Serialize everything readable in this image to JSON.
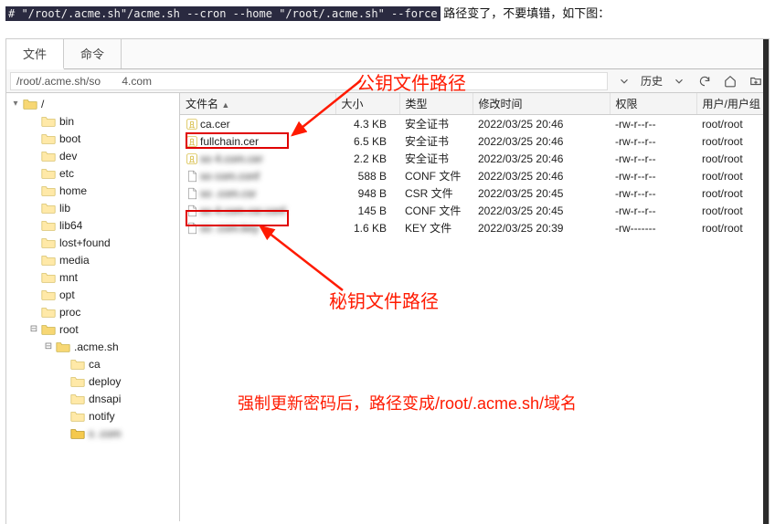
{
  "command_line": "# \"/root/.acme.sh\"/acme.sh --cron --home \"/root/.acme.sh\" --force",
  "command_note": "路径变了，不要填错，如下图：",
  "tabs": {
    "file": "文件",
    "cmd": "命令"
  },
  "path": "/root/.acme.sh/so       4.com",
  "toolbar": {
    "history": "历史"
  },
  "tree_root": "/",
  "tree": [
    {
      "label": "bin",
      "indent": 1
    },
    {
      "label": "boot",
      "indent": 1
    },
    {
      "label": "dev",
      "indent": 1
    },
    {
      "label": "etc",
      "indent": 1
    },
    {
      "label": "home",
      "indent": 1
    },
    {
      "label": "lib",
      "indent": 1
    },
    {
      "label": "lib64",
      "indent": 1
    },
    {
      "label": "lost+found",
      "indent": 1
    },
    {
      "label": "media",
      "indent": 1
    },
    {
      "label": "mnt",
      "indent": 1
    },
    {
      "label": "opt",
      "indent": 1
    },
    {
      "label": "proc",
      "indent": 1
    },
    {
      "label": "root",
      "indent": 1,
      "expandable": true,
      "expanded": true,
      "open": true
    },
    {
      "label": ".acme.sh",
      "indent": 2,
      "expandable": true,
      "expanded": true,
      "open": true
    },
    {
      "label": "ca",
      "indent": 3
    },
    {
      "label": "deploy",
      "indent": 3
    },
    {
      "label": "dnsapi",
      "indent": 3
    },
    {
      "label": "notify",
      "indent": 3
    },
    {
      "label": "s         .com",
      "indent": 3,
      "selected": true,
      "blur": true
    }
  ],
  "columns": {
    "name": "文件名",
    "size": "大小",
    "type": "类型",
    "mod": "修改时间",
    "perm": "权限",
    "owner": "用户/用户组"
  },
  "files": [
    {
      "name": "ca.cer",
      "size": "4.3 KB",
      "type": "安全证书",
      "mod": "2022/03/25 20:46",
      "perm": "-rw-r--r--",
      "owner": "root/root",
      "icon": "cert"
    },
    {
      "name": "fullchain.cer",
      "size": "6.5 KB",
      "type": "安全证书",
      "mod": "2022/03/25 20:46",
      "perm": "-rw-r--r--",
      "owner": "root/root",
      "icon": "cert"
    },
    {
      "name": "so     4.com.cer",
      "size": "2.2 KB",
      "type": "安全证书",
      "mod": "2022/03/25 20:46",
      "perm": "-rw-r--r--",
      "owner": "root/root",
      "icon": "cert",
      "blur": true
    },
    {
      "name": "so       com.conf",
      "size": "588 B",
      "type": "CONF 文件",
      "mod": "2022/03/25 20:46",
      "perm": "-rw-r--r--",
      "owner": "root/root",
      "icon": "file",
      "blur": true
    },
    {
      "name": "so      .com.csr",
      "size": "948 B",
      "type": "CSR 文件",
      "mod": "2022/03/25 20:45",
      "perm": "-rw-r--r--",
      "owner": "root/root",
      "icon": "file",
      "blur": true
    },
    {
      "name": "so     4.com.csr.conf",
      "size": "145 B",
      "type": "CONF 文件",
      "mod": "2022/03/25 20:45",
      "perm": "-rw-r--r--",
      "owner": "root/root",
      "icon": "file",
      "blur": true
    },
    {
      "name": "so      .com.key",
      "size": "1.6 KB",
      "type": "KEY 文件",
      "mod": "2022/03/25 20:39",
      "perm": "-rw-------",
      "owner": "root/root",
      "icon": "file",
      "blur": true
    }
  ],
  "annotations": {
    "pubkey_label": "公钥文件路径",
    "privkey_label": "秘钥文件路径",
    "bottom_note": "强制更新密码后，路径变成/root/.acme.sh/域名"
  }
}
